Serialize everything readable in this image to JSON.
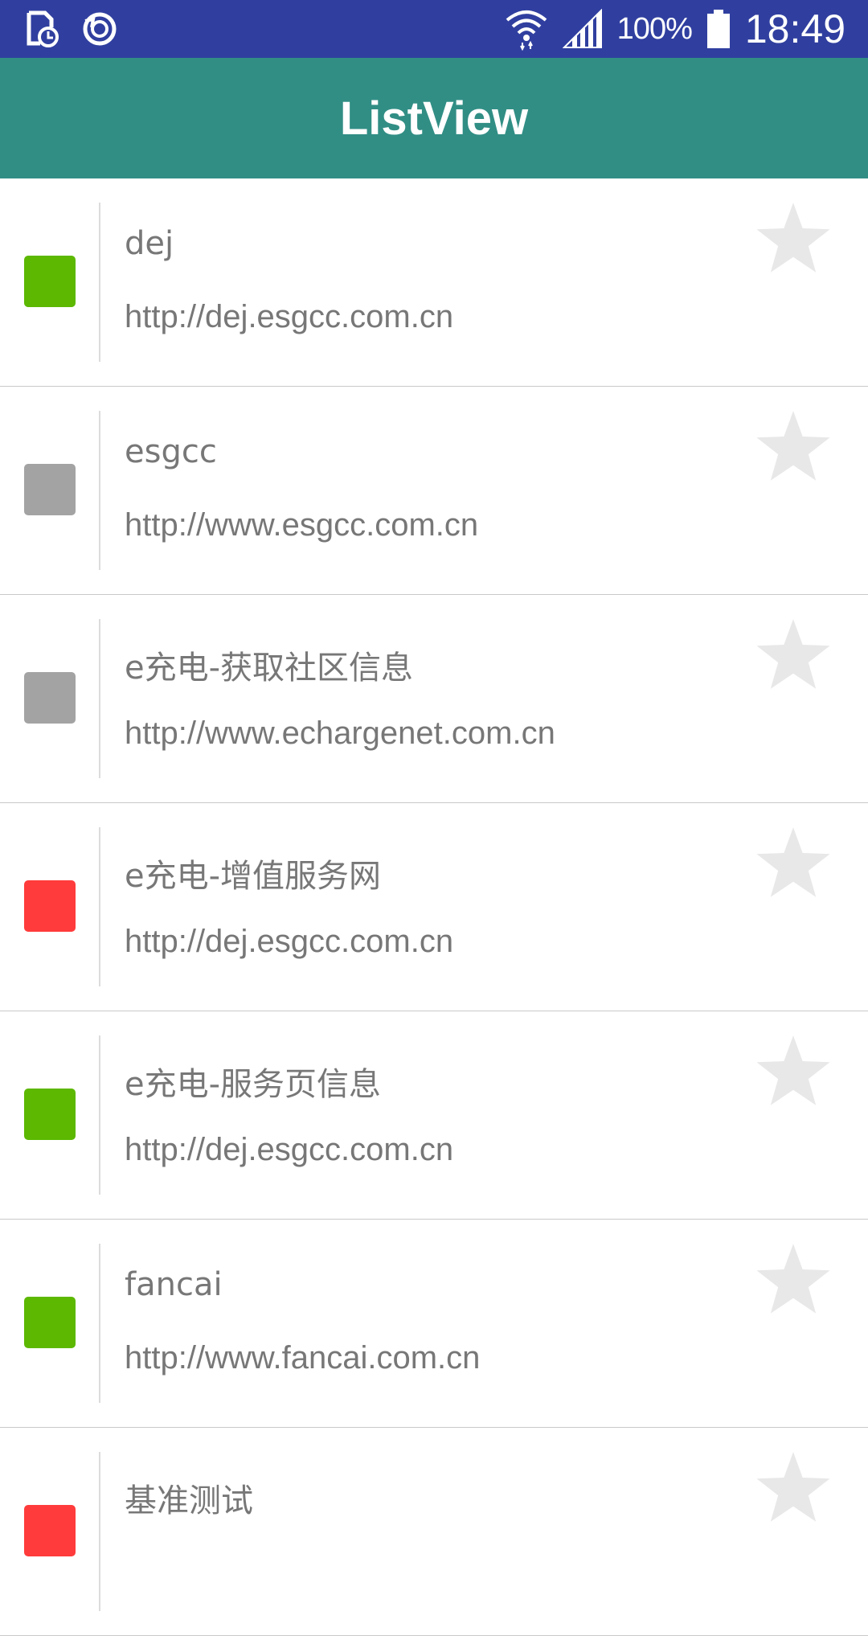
{
  "status_bar": {
    "battery_percent": "100%",
    "time": "18:49",
    "icons": [
      "storage-clock-icon",
      "sync-icon",
      "wifi-icon",
      "signal-icon",
      "battery-icon"
    ]
  },
  "app_bar": {
    "title": "ListView"
  },
  "colors": {
    "status_bar": "#303f9f",
    "app_bar": "#318e85",
    "green": "#5cb800",
    "gray": "#a3a3a3",
    "red": "#ff3b3b",
    "star": "#e8e8e8"
  },
  "items": [
    {
      "title": "dej",
      "url": "http://dej.esgcc.com.cn",
      "status_color": "#5cb800",
      "starred": false
    },
    {
      "title": "esgcc",
      "url": "http://www.esgcc.com.cn",
      "status_color": "#a3a3a3",
      "starred": false
    },
    {
      "title": "e充电-获取社区信息",
      "url": "http://www.echargenet.com.cn",
      "status_color": "#a3a3a3",
      "starred": false
    },
    {
      "title": "e充电-增值服务网",
      "url": "http://dej.esgcc.com.cn",
      "status_color": "#ff3b3b",
      "starred": false
    },
    {
      "title": "e充电-服务页信息",
      "url": "http://dej.esgcc.com.cn",
      "status_color": "#5cb800",
      "starred": false
    },
    {
      "title": "fancai",
      "url": "http://www.fancai.com.cn",
      "status_color": "#5cb800",
      "starred": false
    },
    {
      "title": "基准测试",
      "url": "",
      "status_color": "#ff3b3b",
      "starred": false
    }
  ]
}
